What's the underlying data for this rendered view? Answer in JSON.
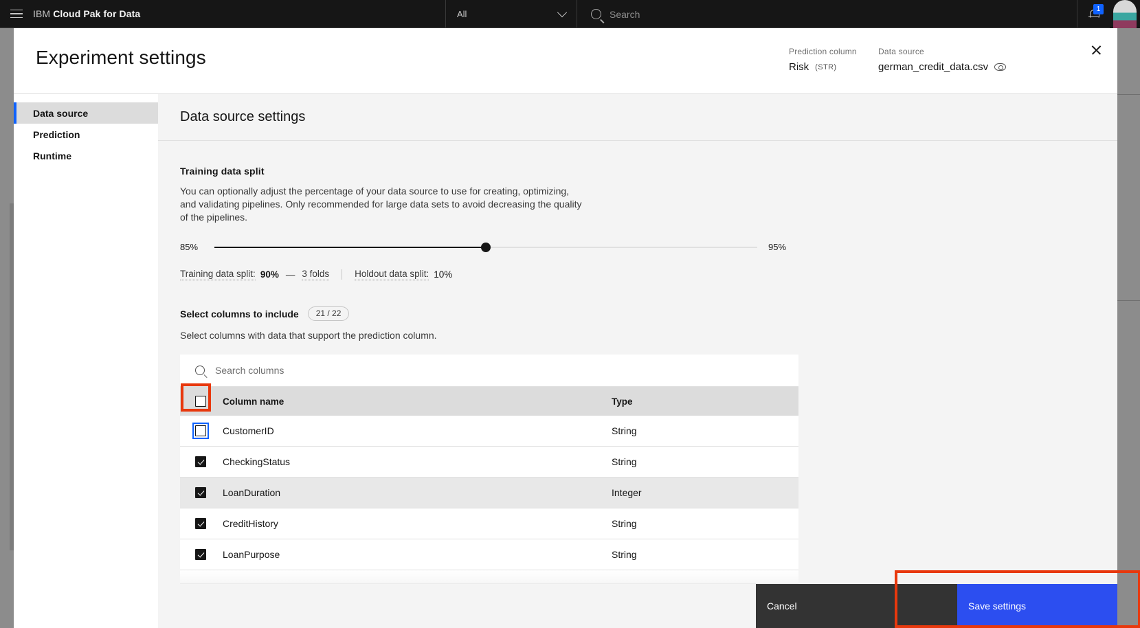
{
  "topnav": {
    "brand_prefix": "IBM ",
    "brand_bold": "Cloud Pak for Data",
    "scope_value": "All",
    "search_placeholder": "Search",
    "notification_count": "1"
  },
  "modal": {
    "title": "Experiment settings",
    "prediction_column": {
      "label": "Prediction column",
      "value": "Risk",
      "type_tag": "(STR)"
    },
    "data_source": {
      "label": "Data source",
      "value": "german_credit_data.csv"
    }
  },
  "sidebar": {
    "items": [
      {
        "label": "Data source",
        "active": true
      },
      {
        "label": "Prediction",
        "active": false
      },
      {
        "label": "Runtime",
        "active": false
      }
    ]
  },
  "content": {
    "heading": "Data source settings",
    "training_split": {
      "title": "Training data split",
      "description": "You can optionally adjust the percentage of your data source to use for creating, optimizing, and validating pipelines. Only recommended for large data sets to avoid decreasing the quality of the pipelines.",
      "slider_min_label": "85%",
      "slider_max_label": "95%",
      "slider_value_percent": 50,
      "info": {
        "training_label": "Training data split:",
        "training_value": "90%",
        "dash": "—",
        "folds": "3 folds",
        "holdout_label": "Holdout data split:",
        "holdout_value": "10%"
      }
    },
    "columns": {
      "title": "Select columns to include",
      "badge": "21 / 22",
      "description": "Select columns with data that support the prediction column.",
      "search_placeholder": "Search columns",
      "headers": {
        "checkbox": "",
        "name": "Column name",
        "type": "Type"
      },
      "rows": [
        {
          "name": "CustomerID",
          "type": "String",
          "checked": false,
          "focused": true,
          "alt": false
        },
        {
          "name": "CheckingStatus",
          "type": "String",
          "checked": true,
          "focused": false,
          "alt": false
        },
        {
          "name": "LoanDuration",
          "type": "Integer",
          "checked": true,
          "focused": false,
          "alt": true
        },
        {
          "name": "CreditHistory",
          "type": "String",
          "checked": true,
          "focused": false,
          "alt": false
        },
        {
          "name": "LoanPurpose",
          "type": "String",
          "checked": true,
          "focused": false,
          "alt": false
        }
      ]
    }
  },
  "footer": {
    "cancel_label": "Cancel",
    "save_label": "Save settings"
  },
  "colors": {
    "accent_blue": "#0f62fe",
    "save_button": "#2c4ef0",
    "annotation_red": "#e8380d",
    "dark_ui": "#161616"
  }
}
